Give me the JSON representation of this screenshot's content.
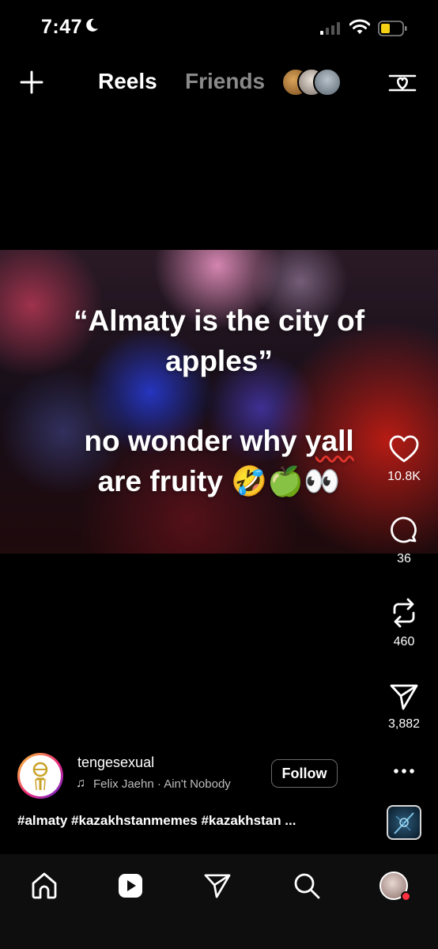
{
  "status_bar": {
    "time": "7:47",
    "icons": [
      "moon-icon",
      "signal-icon",
      "wifi-icon",
      "battery-icon"
    ],
    "battery_color": "#f5d015"
  },
  "top_nav": {
    "tabs": [
      {
        "label": "Reels",
        "active": true
      },
      {
        "label": "Friends",
        "active": false
      }
    ],
    "icons": [
      "plus-icon",
      "friend-avatars",
      "filter-icon"
    ]
  },
  "video": {
    "caption_line1": "“Almaty is the city of",
    "caption_line2": "apples”",
    "caption_line3a": "no wonder why ",
    "caption_line3b": "yall",
    "caption_line4": "are fruity 🤣🍏👀"
  },
  "actions": {
    "like_count": "10.8K",
    "comment_count": "36",
    "repost_count": "460",
    "share_count": "3,882"
  },
  "author": {
    "username": "tengesexual",
    "song": "Felix Jaehn · Ain't Nobody",
    "follow_label": "Follow"
  },
  "hashtags": "#almaty #kazakhstanmemes #kazakhstan ...",
  "bottom_nav": {
    "items": [
      "home-icon",
      "reels-icon",
      "send-icon",
      "search-icon",
      "profile-avatar"
    ]
  },
  "colors": {
    "background": "#000000",
    "inactive_tab": "#8a8a8a",
    "notification_dot": "#ff3040",
    "avatar_ring": [
      "#f9ce34",
      "#ee2a7b",
      "#6228d7"
    ]
  }
}
